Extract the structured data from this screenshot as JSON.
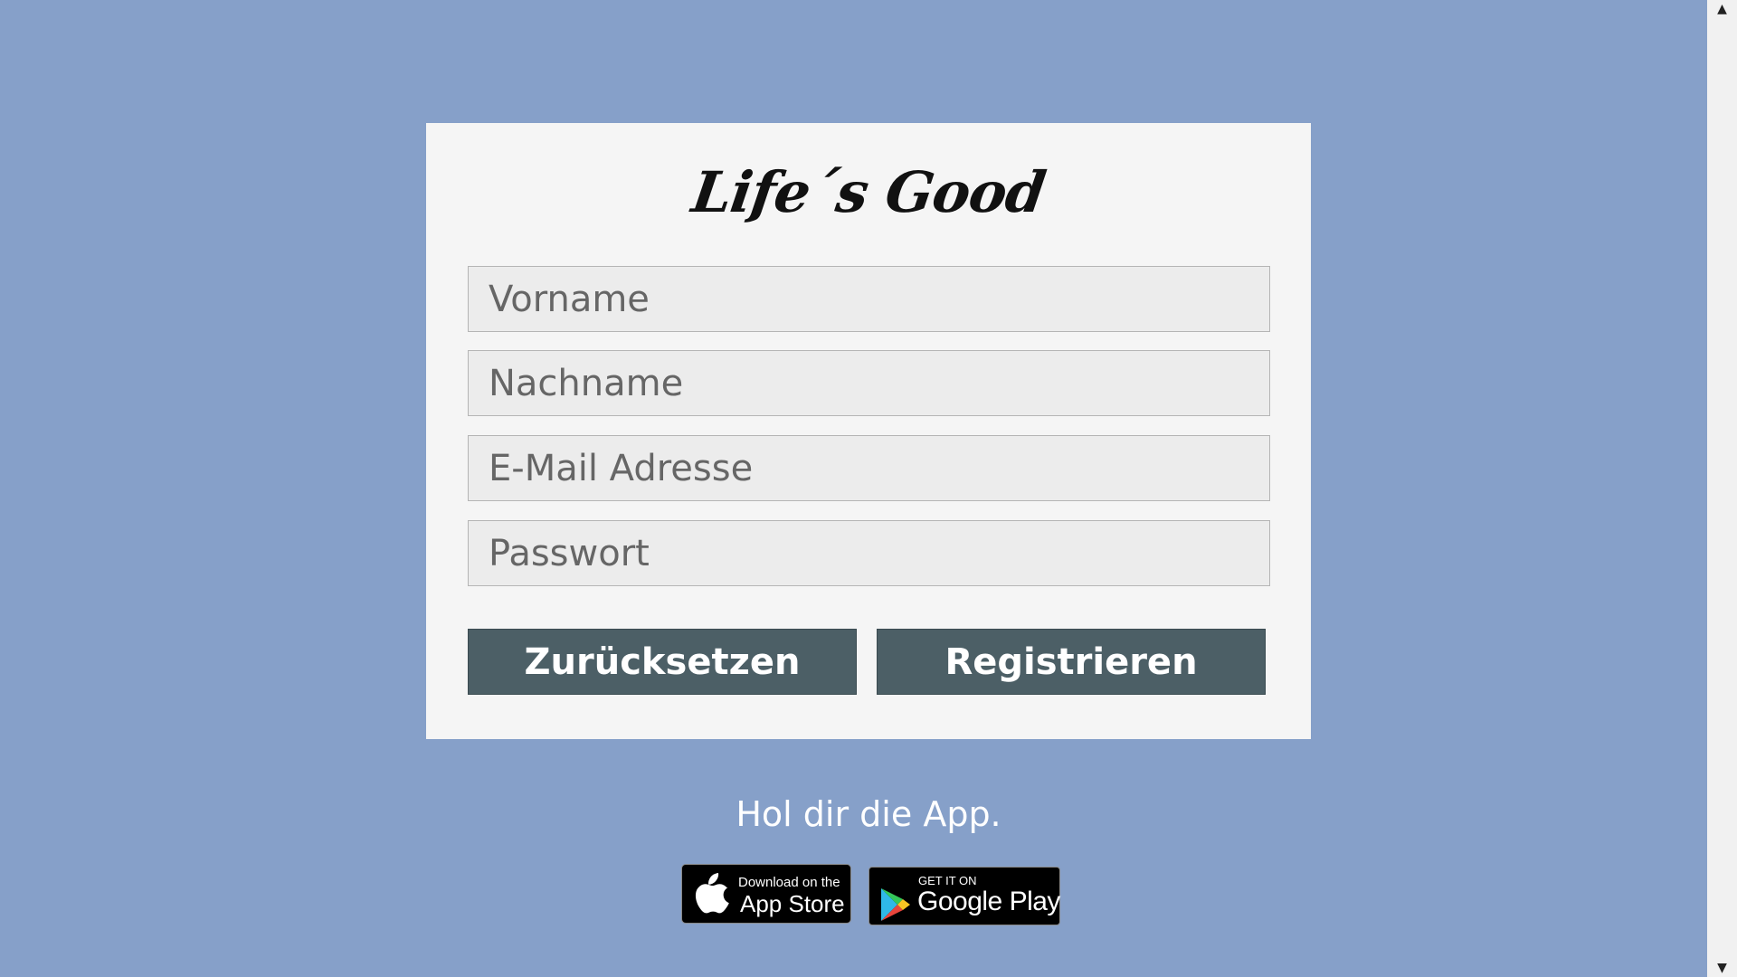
{
  "form": {
    "logo_text": "Life´s Good",
    "fields": [
      {
        "placeholder": "Vorname"
      },
      {
        "placeholder": "Nachname"
      },
      {
        "placeholder": "E-Mail Adresse"
      },
      {
        "placeholder": "Passwort"
      }
    ],
    "reset_label": "Zurücksetzen",
    "register_label": "Registrieren"
  },
  "app_promo": {
    "heading": "Hol dir die App.",
    "app_store": {
      "small": "Download on the",
      "big": "App Store"
    },
    "google_play": {
      "small": "GET IT ON",
      "big": "Google Play"
    }
  },
  "colors": {
    "background": "#86a0c9",
    "card": "#f5f5f5",
    "button": "#4c5f66"
  },
  "scrollbar": {
    "up_icon": "triangle-up",
    "down_icon": "triangle-down"
  }
}
